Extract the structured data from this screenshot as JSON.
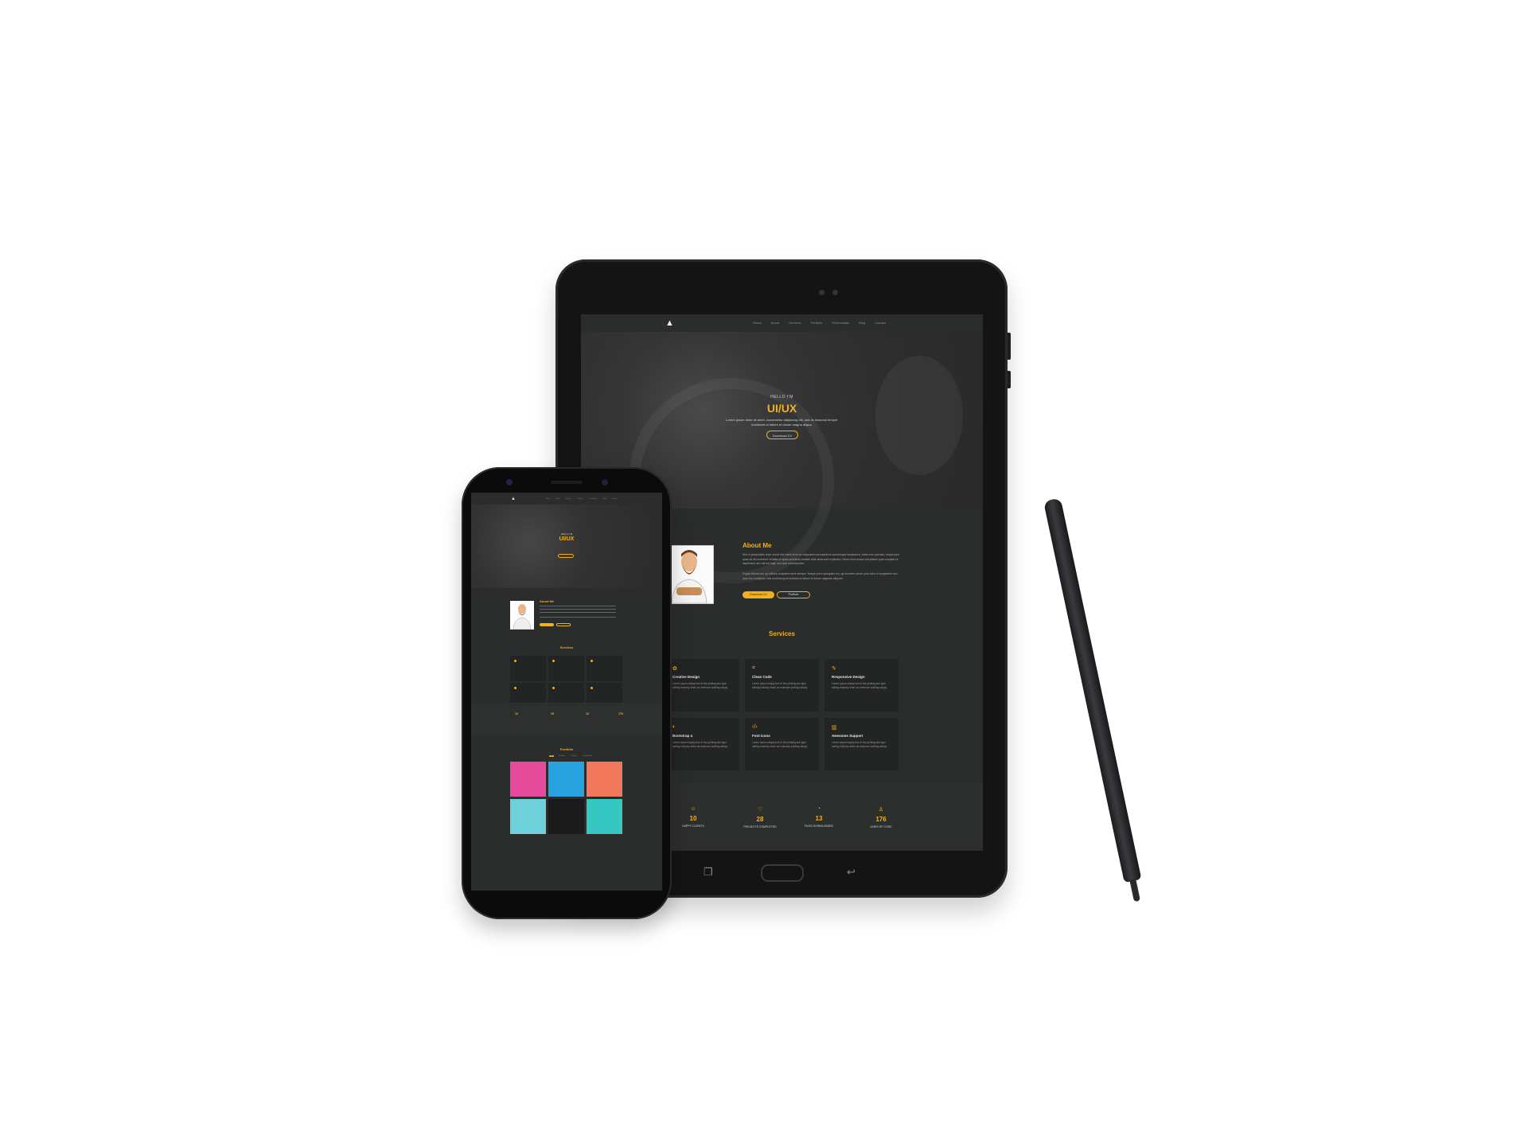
{
  "tablet": {
    "nav": {
      "logo": "▲",
      "items": [
        "Home",
        "About",
        "Services",
        "Portfolio",
        "Testimonials",
        "Blog",
        "Contact"
      ]
    },
    "hero": {
      "hello": "HELLO I'M",
      "role": "UI/UX",
      "description": "Lorem ipsum dolor sit amet, consectetur adipiscing elit, sed do eiusmod tempor incididunt ut labore et dolore magna aliqua.",
      "cv_button": "Download CV"
    },
    "about": {
      "title": "About Me",
      "para1": "Sed ut perspiciatis unde omnis iste natus error sit voluptatem accusantium doloremque laudantium, totam rem aperiam, eaque ipsa quae ab illo inventore veritatis et quasi architecto beatae vitae dicta sunt explicabo. Nemo enim ipsam voluptatem quia voluptas sit aspernatur aut odit aut fugit, sed quia consequuntur.",
      "para2": "Fugiat obtinet non qui offices voluptates esse sneque. Neque porro quisquam est, qui dolorem ipsum quia dolor si voluptatem sed quia non numquam eius modi tempora incidunt ut labore et dolore magnam aliquam.",
      "btn_download": "Download CV",
      "btn_portfolio": "Portfolio"
    },
    "services": {
      "title": "Services",
      "items": [
        {
          "icon": "✿",
          "title": "Creative Design",
          "desc": "Lorem Ipsum simply text of the printing and type setting industry when an unknown printing simply"
        },
        {
          "icon": "⌗",
          "title": "Clean Code",
          "desc": "Lorem Ipsum simply text of the printing and type setting industry when an unknown printing simply"
        },
        {
          "icon": "✎",
          "title": "Responsive Design",
          "desc": "Lorem Ipsum simply text of the printing and type setting industry when an unknown printing simply"
        },
        {
          "icon": "◐",
          "title": "Bootstrap 4",
          "desc": "Lorem Ipsum simply text of the printing and type setting industry when an unknown printing simply"
        },
        {
          "icon": "‹/›",
          "title": "Font Icons",
          "desc": "Lorem Ipsum simply text of the printing and type setting industry when an unknown printing simply"
        },
        {
          "icon": "▥",
          "title": "Awesome Support",
          "desc": "Lorem Ipsum simply text of the printing and type setting industry when an unknown printing simply"
        }
      ]
    },
    "stats": [
      {
        "icon": "☺",
        "number": "10",
        "label": "HAPPY CLIENTS"
      },
      {
        "icon": "♡",
        "number": "28",
        "label": "PROJECTS COMPLETED"
      },
      {
        "icon": "◔",
        "number": "13",
        "label": "FILES DOWNLOADED"
      },
      {
        "icon": "♙",
        "number": "176",
        "label": "LINES OF CODE"
      }
    ]
  },
  "phone": {
    "hero": {
      "hello": "HELLO I'M",
      "role": "UI/UX"
    },
    "about": {
      "title": "About Me"
    },
    "services": {
      "title": "Services"
    },
    "stats": [
      "10",
      "28",
      "13",
      "176"
    ],
    "portfolio": {
      "title": "Portfolio",
      "filters": [
        "All",
        "Branding",
        "Design",
        "Development"
      ],
      "tile_colors": [
        "#e64a9a",
        "#29a3df",
        "#f1785b",
        "#6ed0d8",
        "#1b1b1b",
        "#35c7c2"
      ]
    }
  },
  "colors": {
    "accent": "#f2b01e",
    "screen_bg": "#2b2c2c",
    "card_bg": "#232424"
  }
}
